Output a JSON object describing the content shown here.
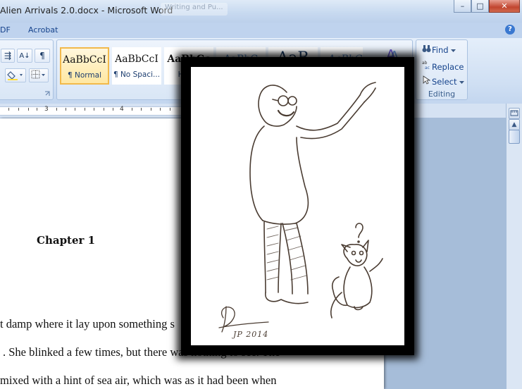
{
  "window": {
    "title": "Alien Arrivals 2.0.docx - Microsoft Word",
    "ghost_tab": "Writing and Pu...",
    "controls": {
      "minimize": "–",
      "maximize": "□",
      "close": "✕"
    }
  },
  "menu": {
    "tabs": [
      "DF",
      "Acrobat"
    ],
    "help": "?"
  },
  "ribbon": {
    "paragraph_buttons": [
      "⇶",
      "A↓",
      "¶"
    ],
    "styles": [
      {
        "sample": "AaBbCcI",
        "name": "¶ Normal"
      },
      {
        "sample": "AaBbCcI",
        "name": "¶ No Spaci..."
      },
      {
        "sample": "AaBbCc",
        "name": "Hea..."
      },
      {
        "sample": "AaBbC",
        "name": ""
      },
      {
        "sample": "AaB",
        "name": ""
      },
      {
        "sample": "AaBbC",
        "name": ""
      }
    ],
    "editing": {
      "label": "Editing",
      "find": "Find",
      "replace": "Replace",
      "select": "Select"
    }
  },
  "ruler": {
    "numbers": [
      "3",
      "4"
    ]
  },
  "document": {
    "chapter_title": "Chapter 1",
    "lines": [
      "t damp where it lay upon something s",
      ". She blinked a few times, but there was nothing to see. The",
      "mixed with a hint of sea air, which was as it had been when"
    ]
  },
  "overlay": {
    "signature": "JP 2014",
    "question_mark": "?"
  },
  "icons": {
    "find": "binoculars-icon",
    "replace": "replace-icon",
    "select": "cursor-icon",
    "help": "help-icon"
  },
  "colors": {
    "title_text": "#222222",
    "tab_text": "#15428b",
    "active_style_border": "#f2b94b",
    "close_button": "#c1452f",
    "overlay_frame": "#000000",
    "sketch_ink": "#4a3c32"
  }
}
